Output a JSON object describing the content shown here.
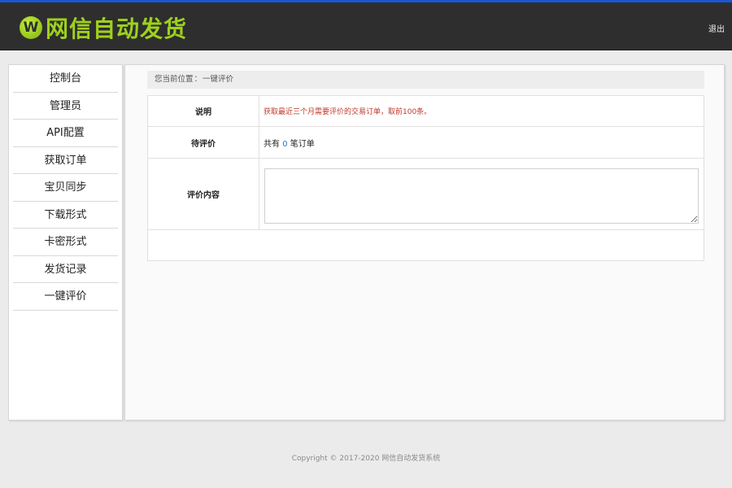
{
  "header": {
    "logo_icon": "W",
    "logo_text": "网信自动发货",
    "logout_label": "退出"
  },
  "sidebar": {
    "items": [
      {
        "label": "控制台"
      },
      {
        "label": "管理员"
      },
      {
        "label": "API配置"
      },
      {
        "label": "获取订单"
      },
      {
        "label": "宝贝同步"
      },
      {
        "label": "下载形式"
      },
      {
        "label": "卡密形式"
      },
      {
        "label": "发货记录"
      },
      {
        "label": "一键评价"
      }
    ]
  },
  "breadcrumb": {
    "prefix": "您当前位置",
    "separator": "：",
    "current": "一键评价"
  },
  "form": {
    "desc_label": "说明",
    "desc_text": "获取最近三个月需要评价的交易订单，取前100条。",
    "pending_label": "待评价",
    "pending_prefix": "共有",
    "pending_count": "0",
    "pending_suffix": "笔订单",
    "content_label": "评价内容",
    "content_value": ""
  },
  "footer": {
    "copyright": "Copyright © 2017-2020 网信自动发货系统"
  },
  "colors": {
    "accent_bar": "#1a56d6",
    "header_bg": "#2e2e2e",
    "logo_green": "#9ed11d",
    "desc_red": "#c0392b",
    "count_blue": "#2f6fd0"
  }
}
